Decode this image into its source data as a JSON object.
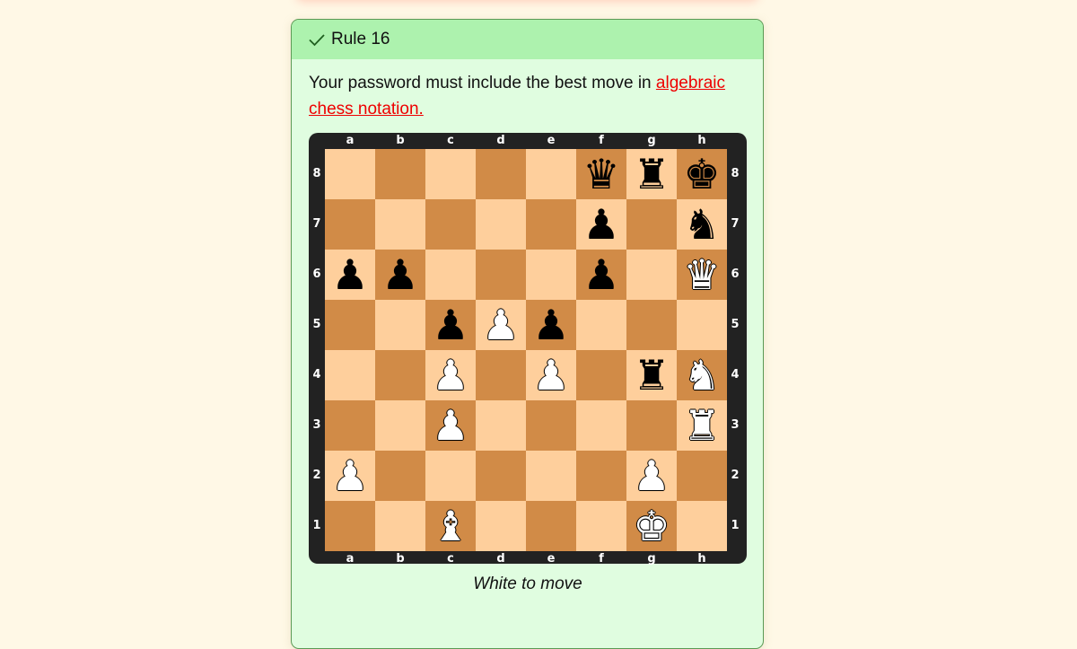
{
  "rule": {
    "title": "Rule 16",
    "status_icon": "check-icon",
    "text_before_link": "Your password must include the best move in ",
    "link_text": "algebraic chess notation.",
    "caption": "White to move"
  },
  "board": {
    "files": [
      "a",
      "b",
      "c",
      "d",
      "e",
      "f",
      "g",
      "h"
    ],
    "ranks": [
      "8",
      "7",
      "6",
      "5",
      "4",
      "3",
      "2",
      "1"
    ],
    "colors": {
      "light": "#fecf9c",
      "dark": "#d18b47",
      "frame": "#222222"
    },
    "pieces": [
      {
        "square": "f8",
        "color": "black",
        "type": "queen"
      },
      {
        "square": "g8",
        "color": "black",
        "type": "rook"
      },
      {
        "square": "h8",
        "color": "black",
        "type": "king"
      },
      {
        "square": "f7",
        "color": "black",
        "type": "pawn"
      },
      {
        "square": "h7",
        "color": "black",
        "type": "knight"
      },
      {
        "square": "a6",
        "color": "black",
        "type": "pawn"
      },
      {
        "square": "b6",
        "color": "black",
        "type": "pawn"
      },
      {
        "square": "f6",
        "color": "black",
        "type": "pawn"
      },
      {
        "square": "h6",
        "color": "white",
        "type": "queen"
      },
      {
        "square": "c5",
        "color": "black",
        "type": "pawn"
      },
      {
        "square": "d5",
        "color": "white",
        "type": "pawn"
      },
      {
        "square": "e5",
        "color": "black",
        "type": "pawn"
      },
      {
        "square": "c4",
        "color": "white",
        "type": "pawn"
      },
      {
        "square": "e4",
        "color": "white",
        "type": "pawn"
      },
      {
        "square": "g4",
        "color": "black",
        "type": "rook"
      },
      {
        "square": "h4",
        "color": "white",
        "type": "knight"
      },
      {
        "square": "c3",
        "color": "white",
        "type": "pawn"
      },
      {
        "square": "h3",
        "color": "white",
        "type": "rook"
      },
      {
        "square": "a2",
        "color": "white",
        "type": "pawn"
      },
      {
        "square": "g2",
        "color": "white",
        "type": "pawn"
      },
      {
        "square": "c1",
        "color": "white",
        "type": "bishop"
      },
      {
        "square": "g1",
        "color": "white",
        "type": "king"
      }
    ]
  }
}
